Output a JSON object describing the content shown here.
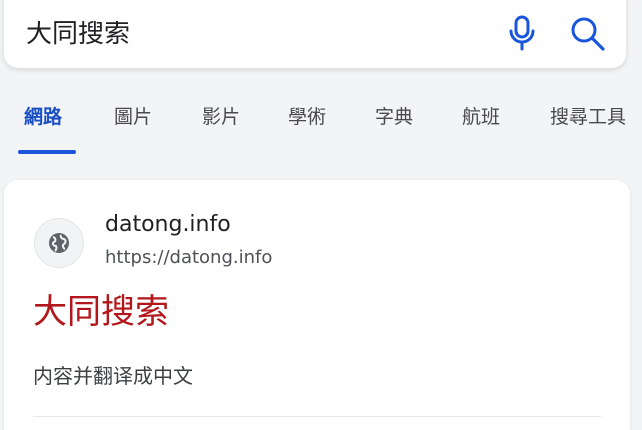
{
  "search": {
    "query": "大同搜索"
  },
  "icons": {
    "mic": "microphone-icon",
    "search": "search-icon",
    "favicon": "globe-icon"
  },
  "colors": {
    "accent": "#1a56db",
    "title_red": "#b3161b"
  },
  "tabs": [
    {
      "label": "網路",
      "active": true
    },
    {
      "label": "圖片",
      "active": false
    },
    {
      "label": "影片",
      "active": false
    },
    {
      "label": "學術",
      "active": false
    },
    {
      "label": "字典",
      "active": false
    },
    {
      "label": "航班",
      "active": false
    },
    {
      "label": "搜尋工具",
      "active": false
    }
  ],
  "result": {
    "site_name": "datong.info",
    "url": "https://datong.info",
    "title": "大同搜索",
    "snippet": "内容并翻译成中文"
  }
}
